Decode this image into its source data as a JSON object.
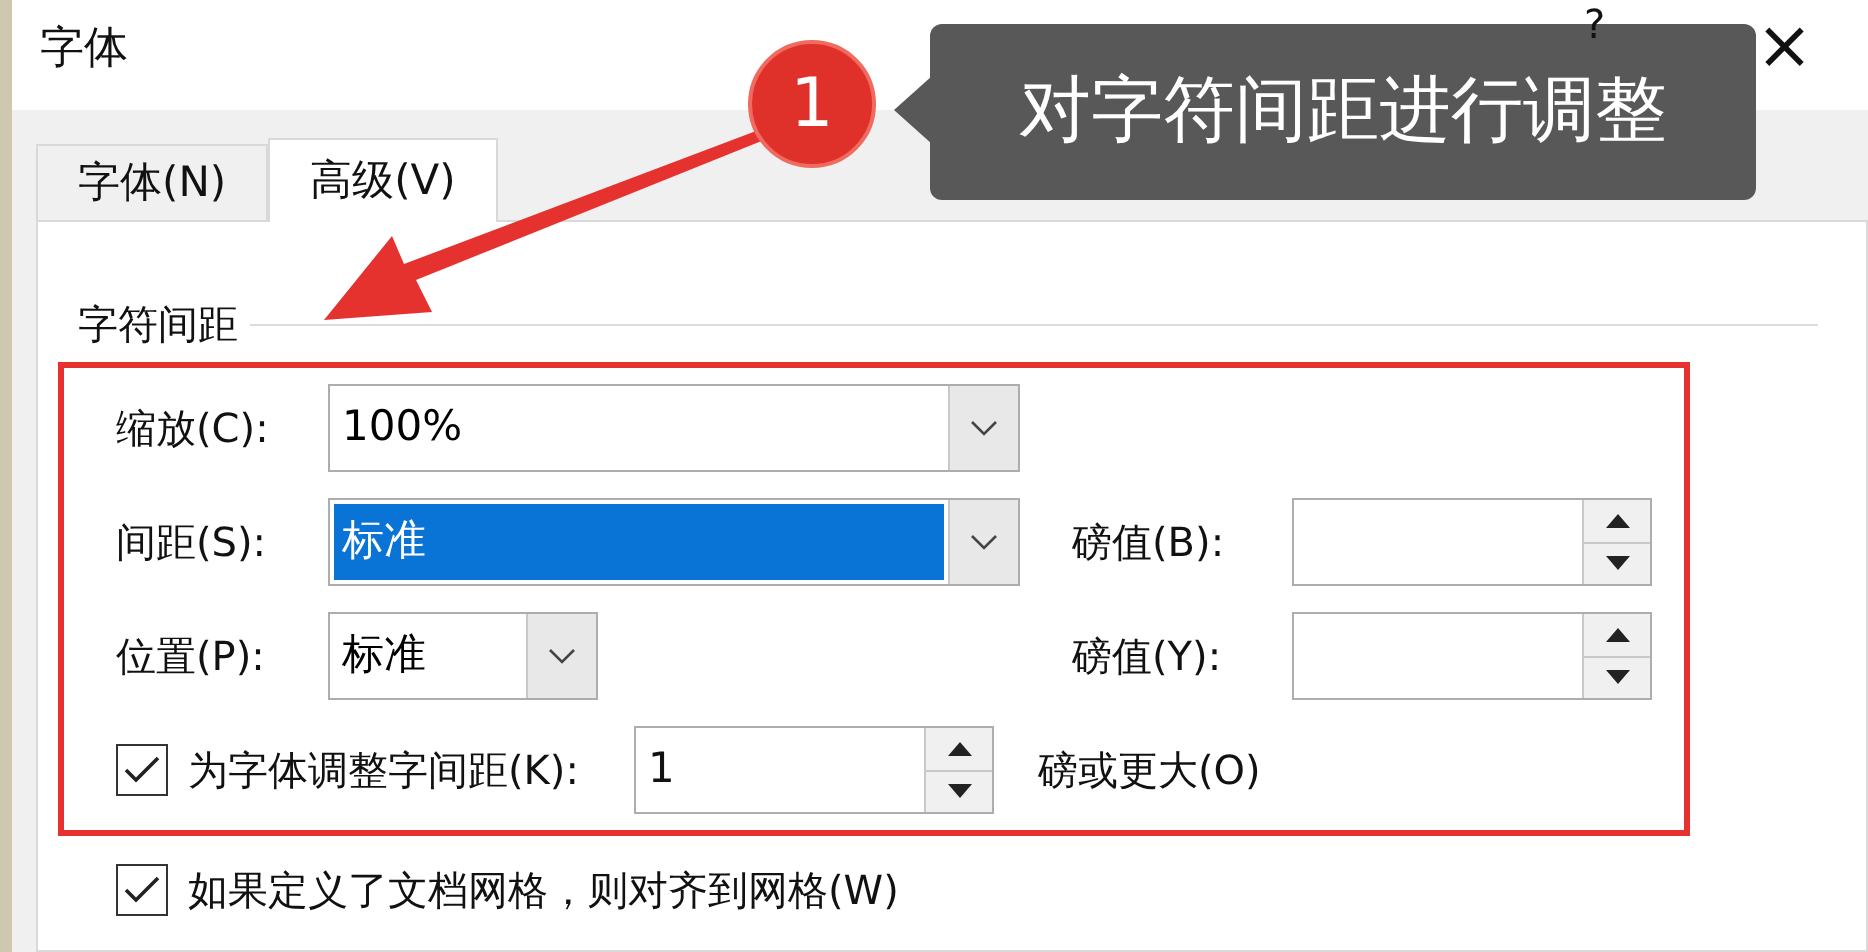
{
  "window": {
    "title": "字体",
    "help_button": "?",
    "close_button": "×"
  },
  "tabs": [
    {
      "label": "字体(N)",
      "selected": false
    },
    {
      "label": "高级(V)",
      "selected": true
    }
  ],
  "section": {
    "title": "字符间距"
  },
  "scale": {
    "label": "缩放(C):",
    "value": "100%"
  },
  "spacing": {
    "label": "间距(S):",
    "value": "标准",
    "highlighted": true,
    "by_label": "磅值(B):"
  },
  "position": {
    "label": "位置(P):",
    "value": "标准",
    "by_label": "磅值(Y):"
  },
  "kerning": {
    "label": "为字体调整字间距(K):",
    "checked": true,
    "value": "1",
    "suffix": "磅或更大(O)"
  },
  "snap_to_grid": {
    "label": "如果定义了文档网格，则对齐到网格(W)",
    "checked": true
  },
  "annotation": {
    "number": "1",
    "text": "对字符间距进行调整"
  }
}
